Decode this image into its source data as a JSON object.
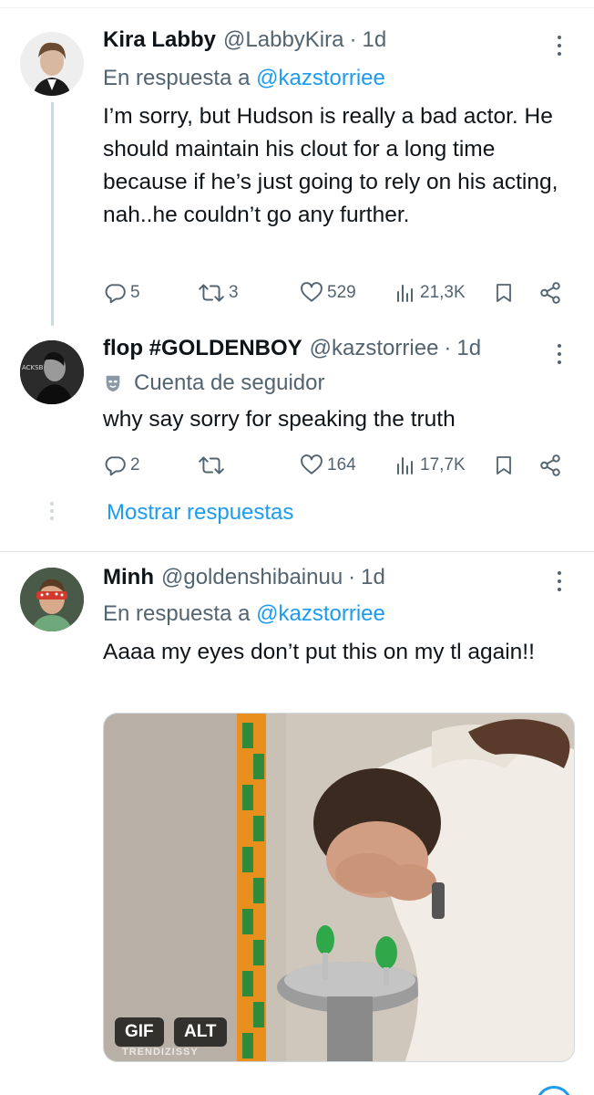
{
  "tweets": [
    {
      "name": "Kira Labby",
      "handle": "@LabbyKira",
      "separator": "·",
      "time": "1d",
      "reply_prefix": "En respuesta a",
      "reply_to": "@kazstorriee",
      "text": "I’m sorry, but Hudson is really a bad actor. He should maintain his clout for a long time because if he’s just going to rely on his acting, nah..he couldn’t go any further.",
      "replies": "5",
      "retweets": "3",
      "likes": "529",
      "views": "21,3K"
    },
    {
      "name": "flop #GOLDENBOY",
      "handle": "@kazstorriee",
      "separator": "·",
      "time": "1d",
      "badge": "Cuenta de seguidor",
      "text": "why say sorry for speaking the truth",
      "replies": "2",
      "retweets": "",
      "likes": "164",
      "views": "17,7K"
    },
    {
      "name": "Minh",
      "handle": "@goldenshibainuu",
      "separator": "·",
      "time": "1d",
      "reply_prefix": "En respuesta a",
      "reply_to": "@kazstorriee",
      "text": "Aaaa my eyes don’t put this on my tl again!!",
      "media": {
        "gif_badge": "GIF",
        "alt_badge": "ALT",
        "watermark": "TRENDIZISSY"
      }
    }
  ],
  "show_replies": "Mostrar respuestas",
  "colors": {
    "accent": "#1d9bf0",
    "secondary_text": "#536471",
    "primary_text": "#0f1419",
    "divider": "#dfe4e7"
  },
  "icons": [
    "reply-icon",
    "retweet-icon",
    "like-icon",
    "views-icon",
    "bookmark-icon",
    "share-icon",
    "more-icon",
    "mask-icon"
  ]
}
